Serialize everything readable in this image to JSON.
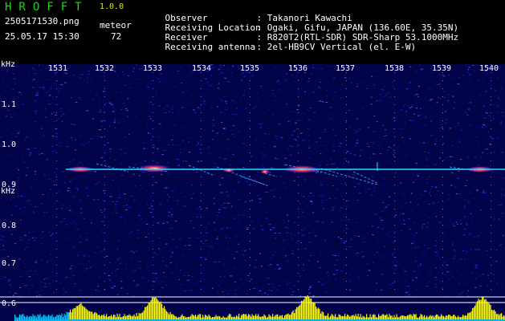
{
  "header": {
    "app_title": "HROFFT",
    "app_version": "1.0.0",
    "filename": "2505171530.png",
    "datetime": "25.05.17 15:30",
    "meteor_label": "meteor",
    "meteor_count": "72",
    "observer_label": "Observer",
    "observer_value": ": Takanori Kawachi",
    "location_label": "Receiving Location",
    "location_value": ": Ogaki, Gifu, JAPAN (136.60E, 35.35N)",
    "receiver_label": "Receiver",
    "receiver_value": ": R820T2(RTL-SDR) SDR-Sharp 53.1000MHz",
    "antenna_label": "Receiving antenna",
    "antenna_value": ": 2el-HB9CV Vertical (el. E-W)"
  },
  "axes": {
    "y_unit": "kHz",
    "y_unit_repeat": "kHz",
    "x_ticks": [
      "1531",
      "1532",
      "1533",
      "1534",
      "1535",
      "1536",
      "1537",
      "1538",
      "1539",
      "1540"
    ],
    "y_ticks": [
      "1.1",
      "1.0",
      "0.9",
      "0.8",
      "0.7",
      "0.6"
    ]
  },
  "colors": {
    "background": "#03034a",
    "carrier": "#2ad9ff",
    "power_bar": "#ffff00",
    "low_bar": "#00c8ff",
    "text": "#ffffff",
    "title": "#11e000"
  }
}
